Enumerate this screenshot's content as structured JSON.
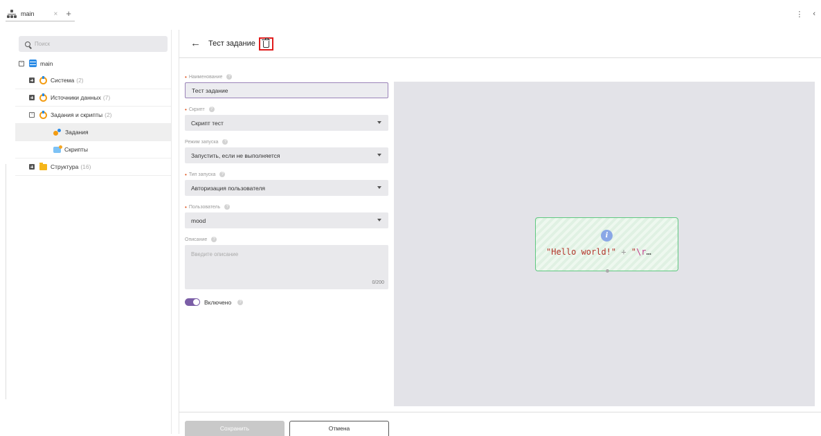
{
  "tabs": [
    {
      "label": "main",
      "close": "×"
    }
  ],
  "tab_add": "+",
  "top_right": {
    "menu": "⋮",
    "collapse": "‹"
  },
  "sidebar": {
    "search_placeholder": "Поиск",
    "tree": [
      {
        "label": "main",
        "count": "",
        "expanded": true,
        "icon": "database-icon"
      },
      {
        "label": "Система",
        "count": "(2)",
        "icon": "system-icon"
      },
      {
        "label": "Источники данных",
        "count": "(7)",
        "icon": "system-icon"
      },
      {
        "label": "Задания и скрипты",
        "count": "(2)",
        "icon": "system-icon",
        "expanded": true
      },
      {
        "label": "Задания",
        "count": "",
        "icon": "tasks-icon",
        "selected": true
      },
      {
        "label": "Скрипты",
        "count": "",
        "icon": "scripts-icon"
      },
      {
        "label": "Структура",
        "count": "(16)",
        "icon": "folder-icon"
      }
    ]
  },
  "header": {
    "back": "←",
    "title": "Тест задание"
  },
  "form": {
    "name": {
      "label": "Наименование",
      "value": "Тест задание"
    },
    "script": {
      "label": "Скрипт",
      "value": "Скрипт тест"
    },
    "run_mode": {
      "label": "Режим запуска",
      "value": "Запустить, если не выполняется"
    },
    "run_type": {
      "label": "Тип запуска",
      "value": "Авторизация пользователя"
    },
    "user": {
      "label": "Пользователь",
      "value": "mood"
    },
    "description": {
      "label": "Описание",
      "placeholder": "Введите описание",
      "counter": "0/200"
    },
    "enabled": {
      "label": "Включено",
      "on": true
    }
  },
  "canvas": {
    "node": {
      "info": "i",
      "code_str1": "\"Hello world!\"",
      "code_plus": " + ",
      "code_str2_open": "\"",
      "code_escape": "\\r",
      "code_ellipsis": "…"
    }
  },
  "footer": {
    "save": "Сохранить",
    "cancel": "Отмена"
  },
  "colors": {
    "accent": "#7b5ea7",
    "highlight": "#e01b1b",
    "node_border": "#5ec77f"
  }
}
